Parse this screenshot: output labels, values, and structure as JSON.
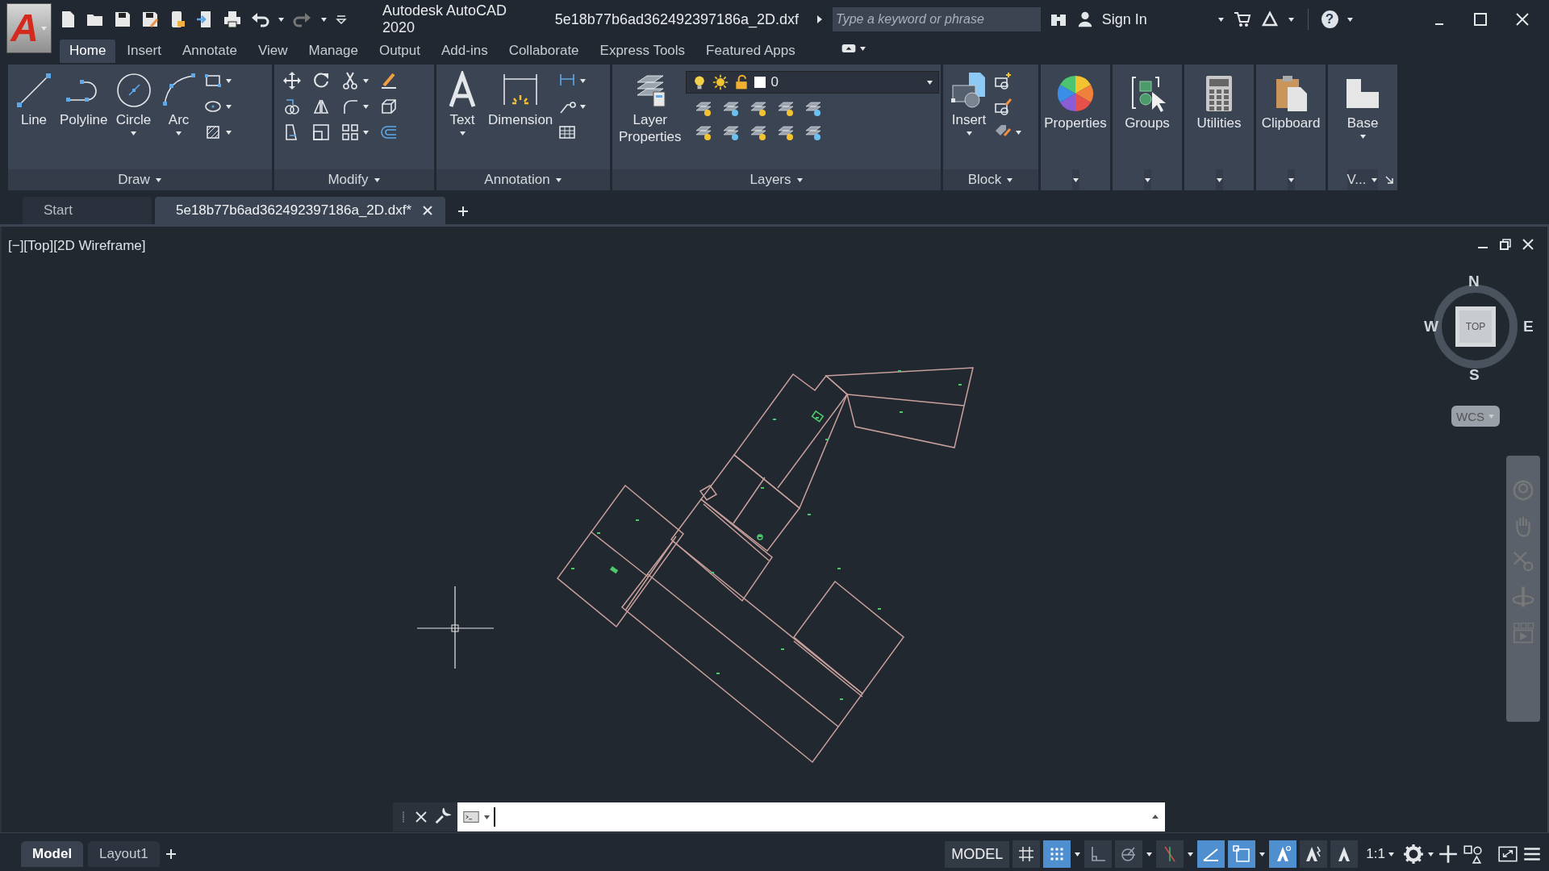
{
  "app_menu": {
    "logo": "A"
  },
  "window": {
    "title": "Autodesk AutoCAD 2020",
    "file": "5e18b77b6ad362492397186a_2D.dxf"
  },
  "search": {
    "placeholder": "Type a keyword or phrase"
  },
  "account": {
    "label": "Sign In"
  },
  "help": {
    "glyph": "?"
  },
  "ribbon_tabs": [
    {
      "label": "Home",
      "selected": true
    },
    {
      "label": "Insert",
      "selected": false
    },
    {
      "label": "Annotate",
      "selected": false
    },
    {
      "label": "View",
      "selected": false
    },
    {
      "label": "Manage",
      "selected": false
    },
    {
      "label": "Output",
      "selected": false
    },
    {
      "label": "Add-ins",
      "selected": false
    },
    {
      "label": "Collaborate",
      "selected": false
    },
    {
      "label": "Express Tools",
      "selected": false
    },
    {
      "label": "Featured Apps",
      "selected": false
    }
  ],
  "panels": [
    {
      "kind": "draw",
      "title": "Draw",
      "tools": [
        {
          "kind": "line",
          "label": "Line"
        },
        {
          "kind": "polyline",
          "label": "Polyline"
        },
        {
          "kind": "circle",
          "label": "Circle"
        },
        {
          "kind": "arc",
          "label": "Arc"
        }
      ]
    },
    {
      "kind": "modify",
      "title": "Modify"
    },
    {
      "kind": "annotation",
      "title": "Annotation",
      "tools": [
        {
          "kind": "text",
          "label": "Text"
        },
        {
          "kind": "dimension",
          "label": "Dimension"
        }
      ]
    },
    {
      "kind": "layers",
      "title": "Layers",
      "tools": [
        {
          "kind": "layers",
          "label": "Layer Properties"
        }
      ],
      "layer": "0"
    },
    {
      "kind": "block",
      "title": "Block",
      "tools": [
        {
          "kind": "insert",
          "label": "Insert"
        }
      ]
    },
    {
      "kind": "single",
      "tools": [
        {
          "kind": "properties",
          "label": "Properties"
        }
      ]
    },
    {
      "kind": "single",
      "tools": [
        {
          "kind": "groups",
          "label": "Groups"
        }
      ]
    },
    {
      "kind": "single",
      "tools": [
        {
          "kind": "utilities",
          "label": "Utilities"
        }
      ]
    },
    {
      "kind": "single",
      "tools": [
        {
          "kind": "clipboard",
          "label": "Clipboard"
        }
      ]
    },
    {
      "kind": "single",
      "title": "V...",
      "tools": [
        {
          "kind": "base",
          "label": "Base"
        }
      ]
    }
  ],
  "doc_tabs": [
    {
      "label": "Start",
      "selected": false
    },
    {
      "label": "5e18b77b6ad362492397186a_2D.dxf*",
      "selected": true
    }
  ],
  "viewport": {
    "label": "[−][Top][2D Wireframe]"
  },
  "viewcube": {
    "north": "N",
    "south": "S",
    "east": "E",
    "west": "W",
    "face": "TOP",
    "ucs": "WCS"
  },
  "layout_tabs": [
    {
      "label": "Model",
      "selected": true
    },
    {
      "label": "Layout1",
      "selected": false
    }
  ],
  "status_bar": {
    "space": "MODEL",
    "scale": "1:1"
  },
  "status_toggles": [
    {
      "kind": "grid",
      "on": false
    },
    {
      "kind": "snap",
      "on": true
    },
    {
      "kind": "ortho",
      "on": false
    },
    {
      "kind": "polar",
      "on": false
    },
    {
      "kind": "osnap_track",
      "on": false
    },
    {
      "kind": "lineweight",
      "on": true
    },
    {
      "kind": "selection",
      "on": true
    },
    {
      "kind": "annotation_visibility",
      "on": true
    },
    {
      "kind": "autoscale",
      "on": false
    },
    {
      "kind": "annotation_scale",
      "on": false
    }
  ]
}
